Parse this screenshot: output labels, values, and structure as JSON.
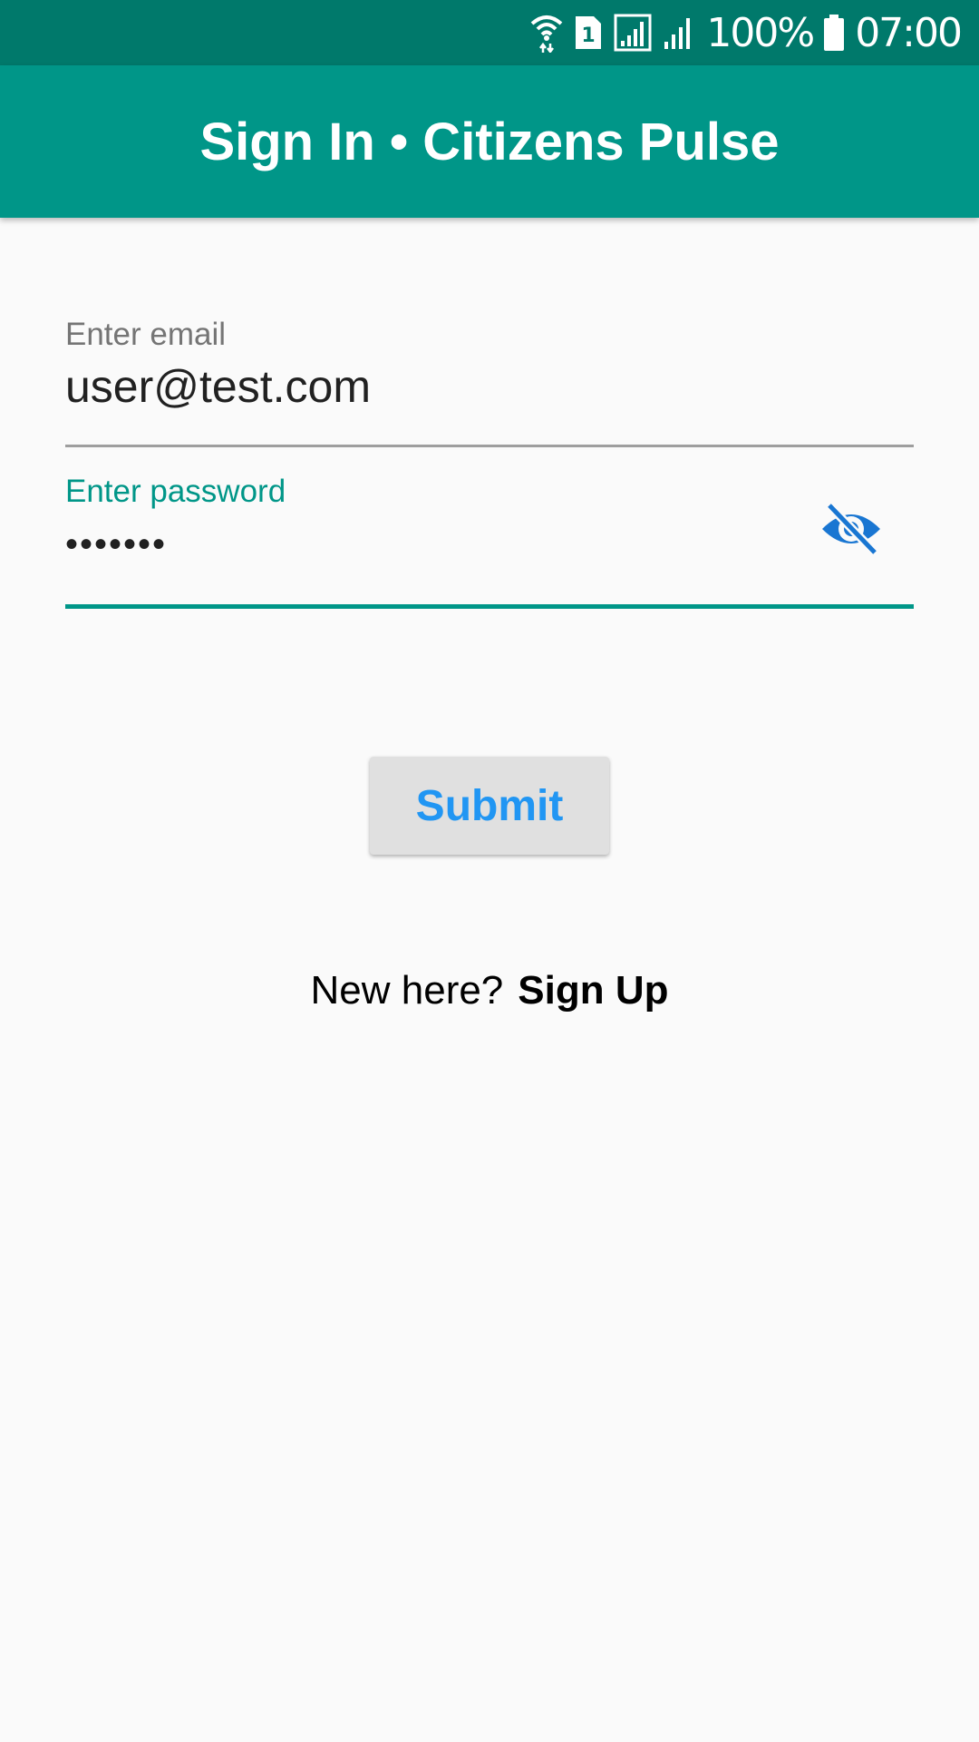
{
  "status_bar": {
    "battery_percent": "100%",
    "time": "07:00",
    "sim_label": "1",
    "icons": [
      "wifi-icon",
      "sim-card-icon",
      "cell-signal-icon",
      "cell-signal-icon",
      "battery-icon"
    ]
  },
  "app_bar": {
    "title": "Sign In • Citizens Pulse"
  },
  "form": {
    "email": {
      "label": "Enter email",
      "value": "user@test.com"
    },
    "password": {
      "label": "Enter password",
      "value": "•••••••",
      "toggle_icon": "visibility-off-icon"
    },
    "submit_label": "Submit"
  },
  "signup": {
    "prompt": "New here?",
    "link_label": "Sign Up"
  },
  "colors": {
    "status_bar": "#00796b",
    "app_bar": "#009688",
    "accent": "#009688",
    "button_text": "#2196f3",
    "eye_icon": "#1976d2",
    "background": "#fafafa"
  }
}
